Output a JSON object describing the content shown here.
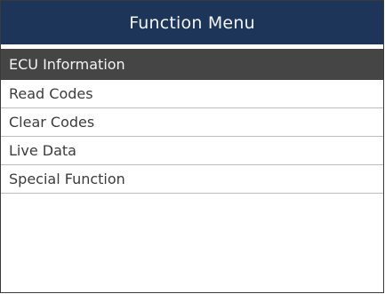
{
  "header": {
    "title": "Function Menu"
  },
  "menu": {
    "items": [
      {
        "label": "ECU Information",
        "selected": true
      },
      {
        "label": "Read Codes",
        "selected": false
      },
      {
        "label": "Clear Codes",
        "selected": false
      },
      {
        "label": "Live Data",
        "selected": false
      },
      {
        "label": "Special Function",
        "selected": false
      }
    ]
  },
  "colors": {
    "title_bar": "#1d3558",
    "selected_row": "#454545",
    "divider": "#bcbcbc"
  }
}
